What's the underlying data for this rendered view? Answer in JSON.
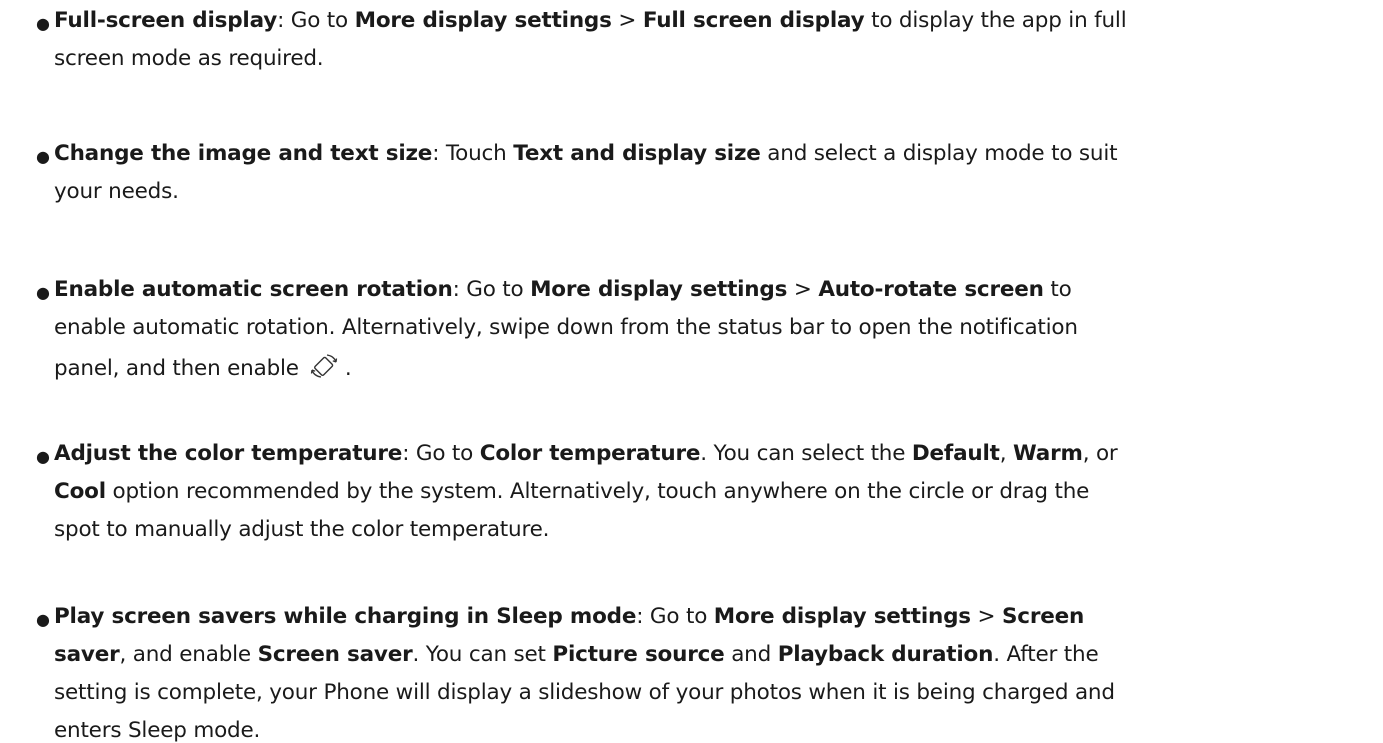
{
  "items": [
    {
      "lines": [
        [
          {
            "t": "Full-screen display",
            "b": true
          },
          {
            "t": ": Go to "
          },
          {
            "t": "More display settings",
            "b": true
          },
          {
            "t": " > "
          },
          {
            "t": "Full screen display",
            "b": true
          },
          {
            "t": " to display the app in full"
          }
        ],
        [
          {
            "t": "screen mode as required."
          }
        ]
      ]
    },
    {
      "lines": [
        [
          {
            "t": "Change the image and text size",
            "b": true
          },
          {
            "t": ": Touch "
          },
          {
            "t": "Text and display size",
            "b": true
          },
          {
            "t": " and select a display mode to suit"
          }
        ],
        [
          {
            "t": "your needs."
          }
        ]
      ]
    },
    {
      "lines": [
        [
          {
            "t": "Enable automatic screen rotation",
            "b": true
          },
          {
            "t": ": Go to "
          },
          {
            "t": "More display settings",
            "b": true
          },
          {
            "t": " > "
          },
          {
            "t": "Auto-rotate screen",
            "b": true
          },
          {
            "t": " to"
          }
        ],
        [
          {
            "t": "enable automatic rotation. Alternatively, swipe down from the status bar to open the notification"
          }
        ],
        [
          {
            "t": "panel, and then enable"
          },
          {
            "icon": "rotate-icon"
          },
          {
            "t": "."
          }
        ]
      ]
    },
    {
      "lines": [
        [
          {
            "t": "Adjust the color temperature",
            "b": true
          },
          {
            "t": ": Go to "
          },
          {
            "t": "Color temperature",
            "b": true
          },
          {
            "t": ". You can select the "
          },
          {
            "t": "Default",
            "b": true
          },
          {
            "t": ", "
          },
          {
            "t": "Warm",
            "b": true
          },
          {
            "t": ", or"
          }
        ],
        [
          {
            "t": "Cool",
            "b": true
          },
          {
            "t": " option recommended by the system. Alternatively, touch anywhere on the circle or drag the"
          }
        ],
        [
          {
            "t": "spot to manually adjust the color temperature."
          }
        ]
      ]
    },
    {
      "lines": [
        [
          {
            "t": "Play screen savers while charging in Sleep mode",
            "b": true
          },
          {
            "t": ": Go to "
          },
          {
            "t": "More display settings",
            "b": true
          },
          {
            "t": " > "
          },
          {
            "t": "Screen",
            "b": true
          }
        ],
        [
          {
            "t": "saver",
            "b": true
          },
          {
            "t": ", and enable "
          },
          {
            "t": "Screen saver",
            "b": true
          },
          {
            "t": ". You can set "
          },
          {
            "t": "Picture source",
            "b": true
          },
          {
            "t": " and "
          },
          {
            "t": "Playback duration",
            "b": true
          },
          {
            "t": ". After the"
          }
        ],
        [
          {
            "t": "setting is complete, your Phone will display a slideshow of your photos when it is being charged and"
          }
        ],
        [
          {
            "t": "enters Sleep mode."
          }
        ]
      ]
    }
  ]
}
